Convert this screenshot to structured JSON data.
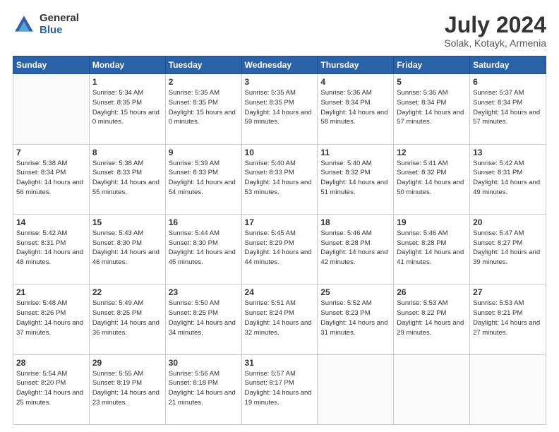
{
  "header": {
    "logo_general": "General",
    "logo_blue": "Blue",
    "title": "July 2024",
    "location": "Solak, Kotayk, Armenia"
  },
  "days_of_week": [
    "Sunday",
    "Monday",
    "Tuesday",
    "Wednesday",
    "Thursday",
    "Friday",
    "Saturday"
  ],
  "weeks": [
    [
      {
        "day": "",
        "info": ""
      },
      {
        "day": "1",
        "info": "Sunrise: 5:34 AM\nSunset: 8:35 PM\nDaylight: 15 hours\nand 0 minutes."
      },
      {
        "day": "2",
        "info": "Sunrise: 5:35 AM\nSunset: 8:35 PM\nDaylight: 15 hours\nand 0 minutes."
      },
      {
        "day": "3",
        "info": "Sunrise: 5:35 AM\nSunset: 8:35 PM\nDaylight: 14 hours\nand 59 minutes."
      },
      {
        "day": "4",
        "info": "Sunrise: 5:36 AM\nSunset: 8:34 PM\nDaylight: 14 hours\nand 58 minutes."
      },
      {
        "day": "5",
        "info": "Sunrise: 5:36 AM\nSunset: 8:34 PM\nDaylight: 14 hours\nand 57 minutes."
      },
      {
        "day": "6",
        "info": "Sunrise: 5:37 AM\nSunset: 8:34 PM\nDaylight: 14 hours\nand 57 minutes."
      }
    ],
    [
      {
        "day": "7",
        "info": "Sunrise: 5:38 AM\nSunset: 8:34 PM\nDaylight: 14 hours\nand 56 minutes."
      },
      {
        "day": "8",
        "info": "Sunrise: 5:38 AM\nSunset: 8:33 PM\nDaylight: 14 hours\nand 55 minutes."
      },
      {
        "day": "9",
        "info": "Sunrise: 5:39 AM\nSunset: 8:33 PM\nDaylight: 14 hours\nand 54 minutes."
      },
      {
        "day": "10",
        "info": "Sunrise: 5:40 AM\nSunset: 8:33 PM\nDaylight: 14 hours\nand 53 minutes."
      },
      {
        "day": "11",
        "info": "Sunrise: 5:40 AM\nSunset: 8:32 PM\nDaylight: 14 hours\nand 51 minutes."
      },
      {
        "day": "12",
        "info": "Sunrise: 5:41 AM\nSunset: 8:32 PM\nDaylight: 14 hours\nand 50 minutes."
      },
      {
        "day": "13",
        "info": "Sunrise: 5:42 AM\nSunset: 8:31 PM\nDaylight: 14 hours\nand 49 minutes."
      }
    ],
    [
      {
        "day": "14",
        "info": "Sunrise: 5:42 AM\nSunset: 8:31 PM\nDaylight: 14 hours\nand 48 minutes."
      },
      {
        "day": "15",
        "info": "Sunrise: 5:43 AM\nSunset: 8:30 PM\nDaylight: 14 hours\nand 46 minutes."
      },
      {
        "day": "16",
        "info": "Sunrise: 5:44 AM\nSunset: 8:30 PM\nDaylight: 14 hours\nand 45 minutes."
      },
      {
        "day": "17",
        "info": "Sunrise: 5:45 AM\nSunset: 8:29 PM\nDaylight: 14 hours\nand 44 minutes."
      },
      {
        "day": "18",
        "info": "Sunrise: 5:46 AM\nSunset: 8:28 PM\nDaylight: 14 hours\nand 42 minutes."
      },
      {
        "day": "19",
        "info": "Sunrise: 5:46 AM\nSunset: 8:28 PM\nDaylight: 14 hours\nand 41 minutes."
      },
      {
        "day": "20",
        "info": "Sunrise: 5:47 AM\nSunset: 8:27 PM\nDaylight: 14 hours\nand 39 minutes."
      }
    ],
    [
      {
        "day": "21",
        "info": "Sunrise: 5:48 AM\nSunset: 8:26 PM\nDaylight: 14 hours\nand 37 minutes."
      },
      {
        "day": "22",
        "info": "Sunrise: 5:49 AM\nSunset: 8:25 PM\nDaylight: 14 hours\nand 36 minutes."
      },
      {
        "day": "23",
        "info": "Sunrise: 5:50 AM\nSunset: 8:25 PM\nDaylight: 14 hours\nand 34 minutes."
      },
      {
        "day": "24",
        "info": "Sunrise: 5:51 AM\nSunset: 8:24 PM\nDaylight: 14 hours\nand 32 minutes."
      },
      {
        "day": "25",
        "info": "Sunrise: 5:52 AM\nSunset: 8:23 PM\nDaylight: 14 hours\nand 31 minutes."
      },
      {
        "day": "26",
        "info": "Sunrise: 5:53 AM\nSunset: 8:22 PM\nDaylight: 14 hours\nand 29 minutes."
      },
      {
        "day": "27",
        "info": "Sunrise: 5:53 AM\nSunset: 8:21 PM\nDaylight: 14 hours\nand 27 minutes."
      }
    ],
    [
      {
        "day": "28",
        "info": "Sunrise: 5:54 AM\nSunset: 8:20 PM\nDaylight: 14 hours\nand 25 minutes."
      },
      {
        "day": "29",
        "info": "Sunrise: 5:55 AM\nSunset: 8:19 PM\nDaylight: 14 hours\nand 23 minutes."
      },
      {
        "day": "30",
        "info": "Sunrise: 5:56 AM\nSunset: 8:18 PM\nDaylight: 14 hours\nand 21 minutes."
      },
      {
        "day": "31",
        "info": "Sunrise: 5:57 AM\nSunset: 8:17 PM\nDaylight: 14 hours\nand 19 minutes."
      },
      {
        "day": "",
        "info": ""
      },
      {
        "day": "",
        "info": ""
      },
      {
        "day": "",
        "info": ""
      }
    ]
  ]
}
